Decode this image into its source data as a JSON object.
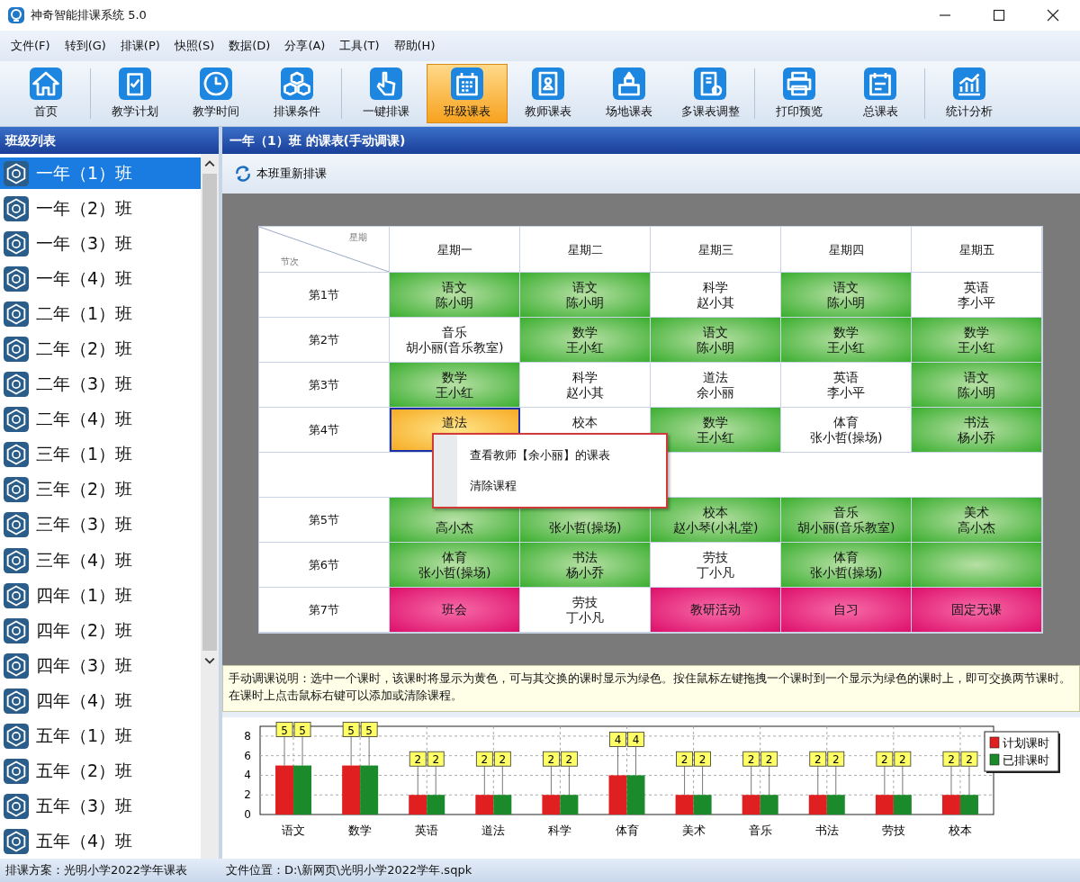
{
  "window": {
    "title": "神奇智能排课系统 5.0"
  },
  "menu": [
    "文件(F)",
    "转到(G)",
    "排课(P)",
    "快照(S)",
    "数据(D)",
    "分享(A)",
    "工具(T)",
    "帮助(H)"
  ],
  "toolbar": [
    {
      "label": "首页",
      "selected": false
    },
    {
      "label": "教学计划",
      "selected": false
    },
    {
      "label": "教学时间",
      "selected": false
    },
    {
      "label": "排课条件",
      "selected": false
    },
    {
      "label": "一键排课",
      "selected": false
    },
    {
      "label": "班级课表",
      "selected": true
    },
    {
      "label": "教师课表",
      "selected": false
    },
    {
      "label": "场地课表",
      "selected": false
    },
    {
      "label": "多课表调整",
      "selected": false
    },
    {
      "label": "打印预览",
      "selected": false
    },
    {
      "label": "总课表",
      "selected": false
    },
    {
      "label": "统计分析",
      "selected": false
    }
  ],
  "sidebar": {
    "title": "班级列表",
    "items": [
      {
        "label": "一年（1）班",
        "selected": true
      },
      {
        "label": "一年（2）班",
        "selected": false
      },
      {
        "label": "一年（3）班",
        "selected": false
      },
      {
        "label": "一年（4）班",
        "selected": false
      },
      {
        "label": "二年（1）班",
        "selected": false
      },
      {
        "label": "二年（2）班",
        "selected": false
      },
      {
        "label": "二年（3）班",
        "selected": false
      },
      {
        "label": "二年（4）班",
        "selected": false
      },
      {
        "label": "三年（1）班",
        "selected": false
      },
      {
        "label": "三年（2）班",
        "selected": false
      },
      {
        "label": "三年（3）班",
        "selected": false
      },
      {
        "label": "三年（4）班",
        "selected": false
      },
      {
        "label": "四年（1）班",
        "selected": false
      },
      {
        "label": "四年（2）班",
        "selected": false
      },
      {
        "label": "四年（3）班",
        "selected": false
      },
      {
        "label": "四年（4）班",
        "selected": false
      },
      {
        "label": "五年（1）班",
        "selected": false
      },
      {
        "label": "五年（2）班",
        "selected": false
      },
      {
        "label": "五年（3）班",
        "selected": false
      },
      {
        "label": "五年（4）班",
        "selected": false
      }
    ]
  },
  "panel": {
    "title": "一年（1）班 的课表(手动调课)",
    "action": "本班重新排课"
  },
  "timetable": {
    "corner_top": "星期",
    "corner_bottom": "节次",
    "days": [
      "星期一",
      "星期二",
      "星期三",
      "星期四",
      "星期五"
    ],
    "rows": [
      {
        "kind": "period",
        "label": "第1节",
        "cells": [
          {
            "kind": "swap",
            "lines": [
              "语文",
              "陈小明"
            ]
          },
          {
            "kind": "swap",
            "lines": [
              "语文",
              "陈小明"
            ]
          },
          {
            "kind": "normal",
            "lines": [
              "科学",
              "赵小其"
            ]
          },
          {
            "kind": "swap",
            "lines": [
              "语文",
              "陈小明"
            ]
          },
          {
            "kind": "normal",
            "lines": [
              "英语",
              "李小平"
            ]
          }
        ]
      },
      {
        "kind": "period",
        "label": "第2节",
        "cells": [
          {
            "kind": "normal",
            "lines": [
              "音乐",
              "胡小丽(音乐教室)"
            ]
          },
          {
            "kind": "swap",
            "lines": [
              "数学",
              "王小红"
            ]
          },
          {
            "kind": "swap",
            "lines": [
              "语文",
              "陈小明"
            ]
          },
          {
            "kind": "swap",
            "lines": [
              "数学",
              "王小红"
            ]
          },
          {
            "kind": "swap",
            "lines": [
              "数学",
              "王小红"
            ]
          }
        ]
      },
      {
        "kind": "period",
        "label": "第3节",
        "cells": [
          {
            "kind": "swap",
            "lines": [
              "数学",
              "王小红"
            ]
          },
          {
            "kind": "normal",
            "lines": [
              "科学",
              "赵小其"
            ]
          },
          {
            "kind": "normal",
            "lines": [
              "道法",
              "余小丽"
            ]
          },
          {
            "kind": "normal",
            "lines": [
              "英语",
              "李小平"
            ]
          },
          {
            "kind": "swap",
            "lines": [
              "语文",
              "陈小明"
            ]
          }
        ]
      },
      {
        "kind": "period",
        "label": "第4节",
        "cells": [
          {
            "kind": "selected",
            "lines": [
              "道法"
            ],
            "lower_line_hidden": true
          },
          {
            "kind": "normal",
            "lines": [
              "校本"
            ],
            "lower_line_hidden": true
          },
          {
            "kind": "swap",
            "lines": [
              "数学",
              "王小红"
            ]
          },
          {
            "kind": "normal",
            "lines": [
              "体育",
              "张小哲(操场)"
            ]
          },
          {
            "kind": "swap",
            "lines": [
              "书法",
              "杨小乔"
            ]
          }
        ]
      },
      {
        "kind": "break"
      },
      {
        "kind": "period",
        "label": "第5节",
        "cells": [
          {
            "kind": "swap",
            "lines": [
              "高小杰"
            ],
            "upper_line_hidden": true
          },
          {
            "kind": "swap",
            "lines": [
              "张小哲(操场)"
            ],
            "upper_line_hidden": true
          },
          {
            "kind": "swap",
            "lines": [
              "校本",
              "赵小琴(小礼堂)"
            ]
          },
          {
            "kind": "swap",
            "lines": [
              "音乐",
              "胡小丽(音乐教室)"
            ]
          },
          {
            "kind": "swap",
            "lines": [
              "美术",
              "高小杰"
            ]
          }
        ]
      },
      {
        "kind": "period",
        "label": "第6节",
        "cells": [
          {
            "kind": "swap",
            "lines": [
              "体育",
              "张小哲(操场)"
            ]
          },
          {
            "kind": "swap",
            "lines": [
              "书法",
              "杨小乔"
            ]
          },
          {
            "kind": "normal",
            "lines": [
              "劳技",
              "丁小凡"
            ]
          },
          {
            "kind": "swap",
            "lines": [
              "体育",
              "张小哲(操场)"
            ]
          },
          {
            "kind": "swap"
          }
        ]
      },
      {
        "kind": "period",
        "label": "第7节",
        "cells": [
          {
            "kind": "fixed",
            "lines": [
              "班会"
            ]
          },
          {
            "kind": "normal",
            "lines": [
              "劳技",
              "丁小凡"
            ]
          },
          {
            "kind": "fixed",
            "lines": [
              "教研活动"
            ]
          },
          {
            "kind": "fixed",
            "lines": [
              "自习"
            ]
          },
          {
            "kind": "fixed",
            "lines": [
              "固定无课"
            ]
          }
        ]
      }
    ]
  },
  "context_menu": [
    "查看教师【余小丽】的课表",
    "清除课程"
  ],
  "instructions": "手动调课说明：选中一个课时，该课时将显示为黄色，可与其交换的课时显示为绿色。按住鼠标左键拖拽一个课时到一个显示为绿色的课时上，即可交换两节课时。在课时上点击鼠标右键可以添加或清除课程。",
  "chart_data": {
    "type": "bar",
    "categories": [
      "语文",
      "数学",
      "英语",
      "道法",
      "科学",
      "体育",
      "美术",
      "音乐",
      "书法",
      "劳技",
      "校本"
    ],
    "series": [
      {
        "name": "计划课时",
        "color": "#e02020",
        "values": [
          5,
          5,
          2,
          2,
          2,
          4,
          2,
          2,
          2,
          2,
          2
        ]
      },
      {
        "name": "已排课时",
        "color": "#1a8a2a",
        "values": [
          5,
          5,
          2,
          2,
          2,
          4,
          2,
          2,
          2,
          2,
          2
        ]
      }
    ],
    "yticks": [
      0,
      2,
      4,
      6,
      8
    ],
    "ylim": [
      0,
      9
    ],
    "data_labels": true,
    "grid": true,
    "legend": "right"
  },
  "status_bar": {
    "plan": "排课方案：光明小学2022学年课表",
    "file": "文件位置：D:\\新网页\\光明小学2022学年.sqpk"
  }
}
